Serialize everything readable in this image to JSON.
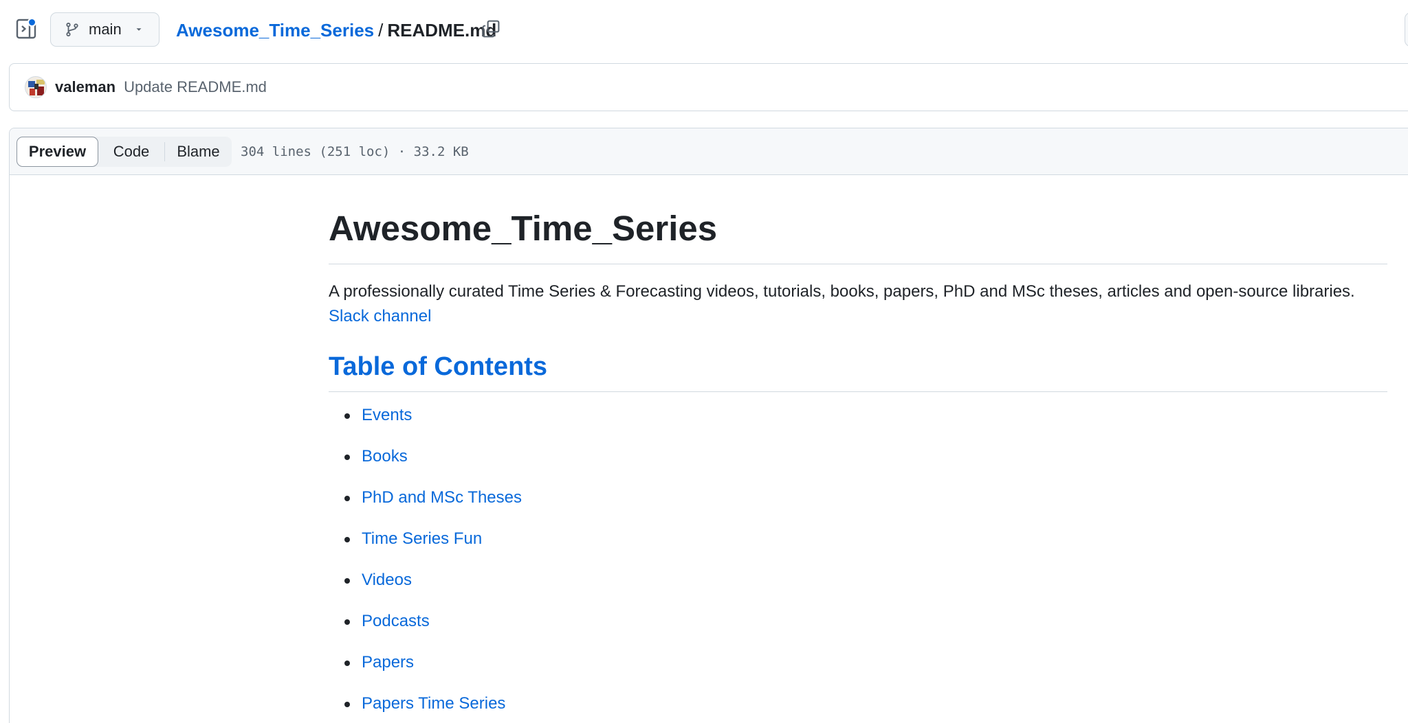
{
  "topbar": {
    "branch": "main",
    "repo_name": "Awesome_Time_Series",
    "separator": "/",
    "file_name": "README.md"
  },
  "commit": {
    "author": "valeman",
    "message": "Update README.md"
  },
  "file_view": {
    "tabs": [
      "Preview",
      "Code",
      "Blame"
    ],
    "active_tab": "Preview",
    "info": "304 lines (251 loc) · 33.2 KB"
  },
  "readme": {
    "title": "Awesome_Time_Series",
    "description": "A professionally curated Time Series & Forecasting videos, tutorials, books, papers, PhD and MSc theses, articles and open-source libraries.",
    "slack_link": "Slack channel",
    "toc_heading": "Table of Contents",
    "toc_items": [
      "Events",
      "Books",
      "PhD and MSc Theses",
      "Time Series Fun",
      "Videos",
      "Podcasts",
      "Papers",
      "Papers Time Series"
    ]
  },
  "colors": {
    "link": "#0969da",
    "text": "#1f2328",
    "muted": "#59636e",
    "border": "#d1d9e0",
    "header_bg": "#f6f8fa"
  }
}
